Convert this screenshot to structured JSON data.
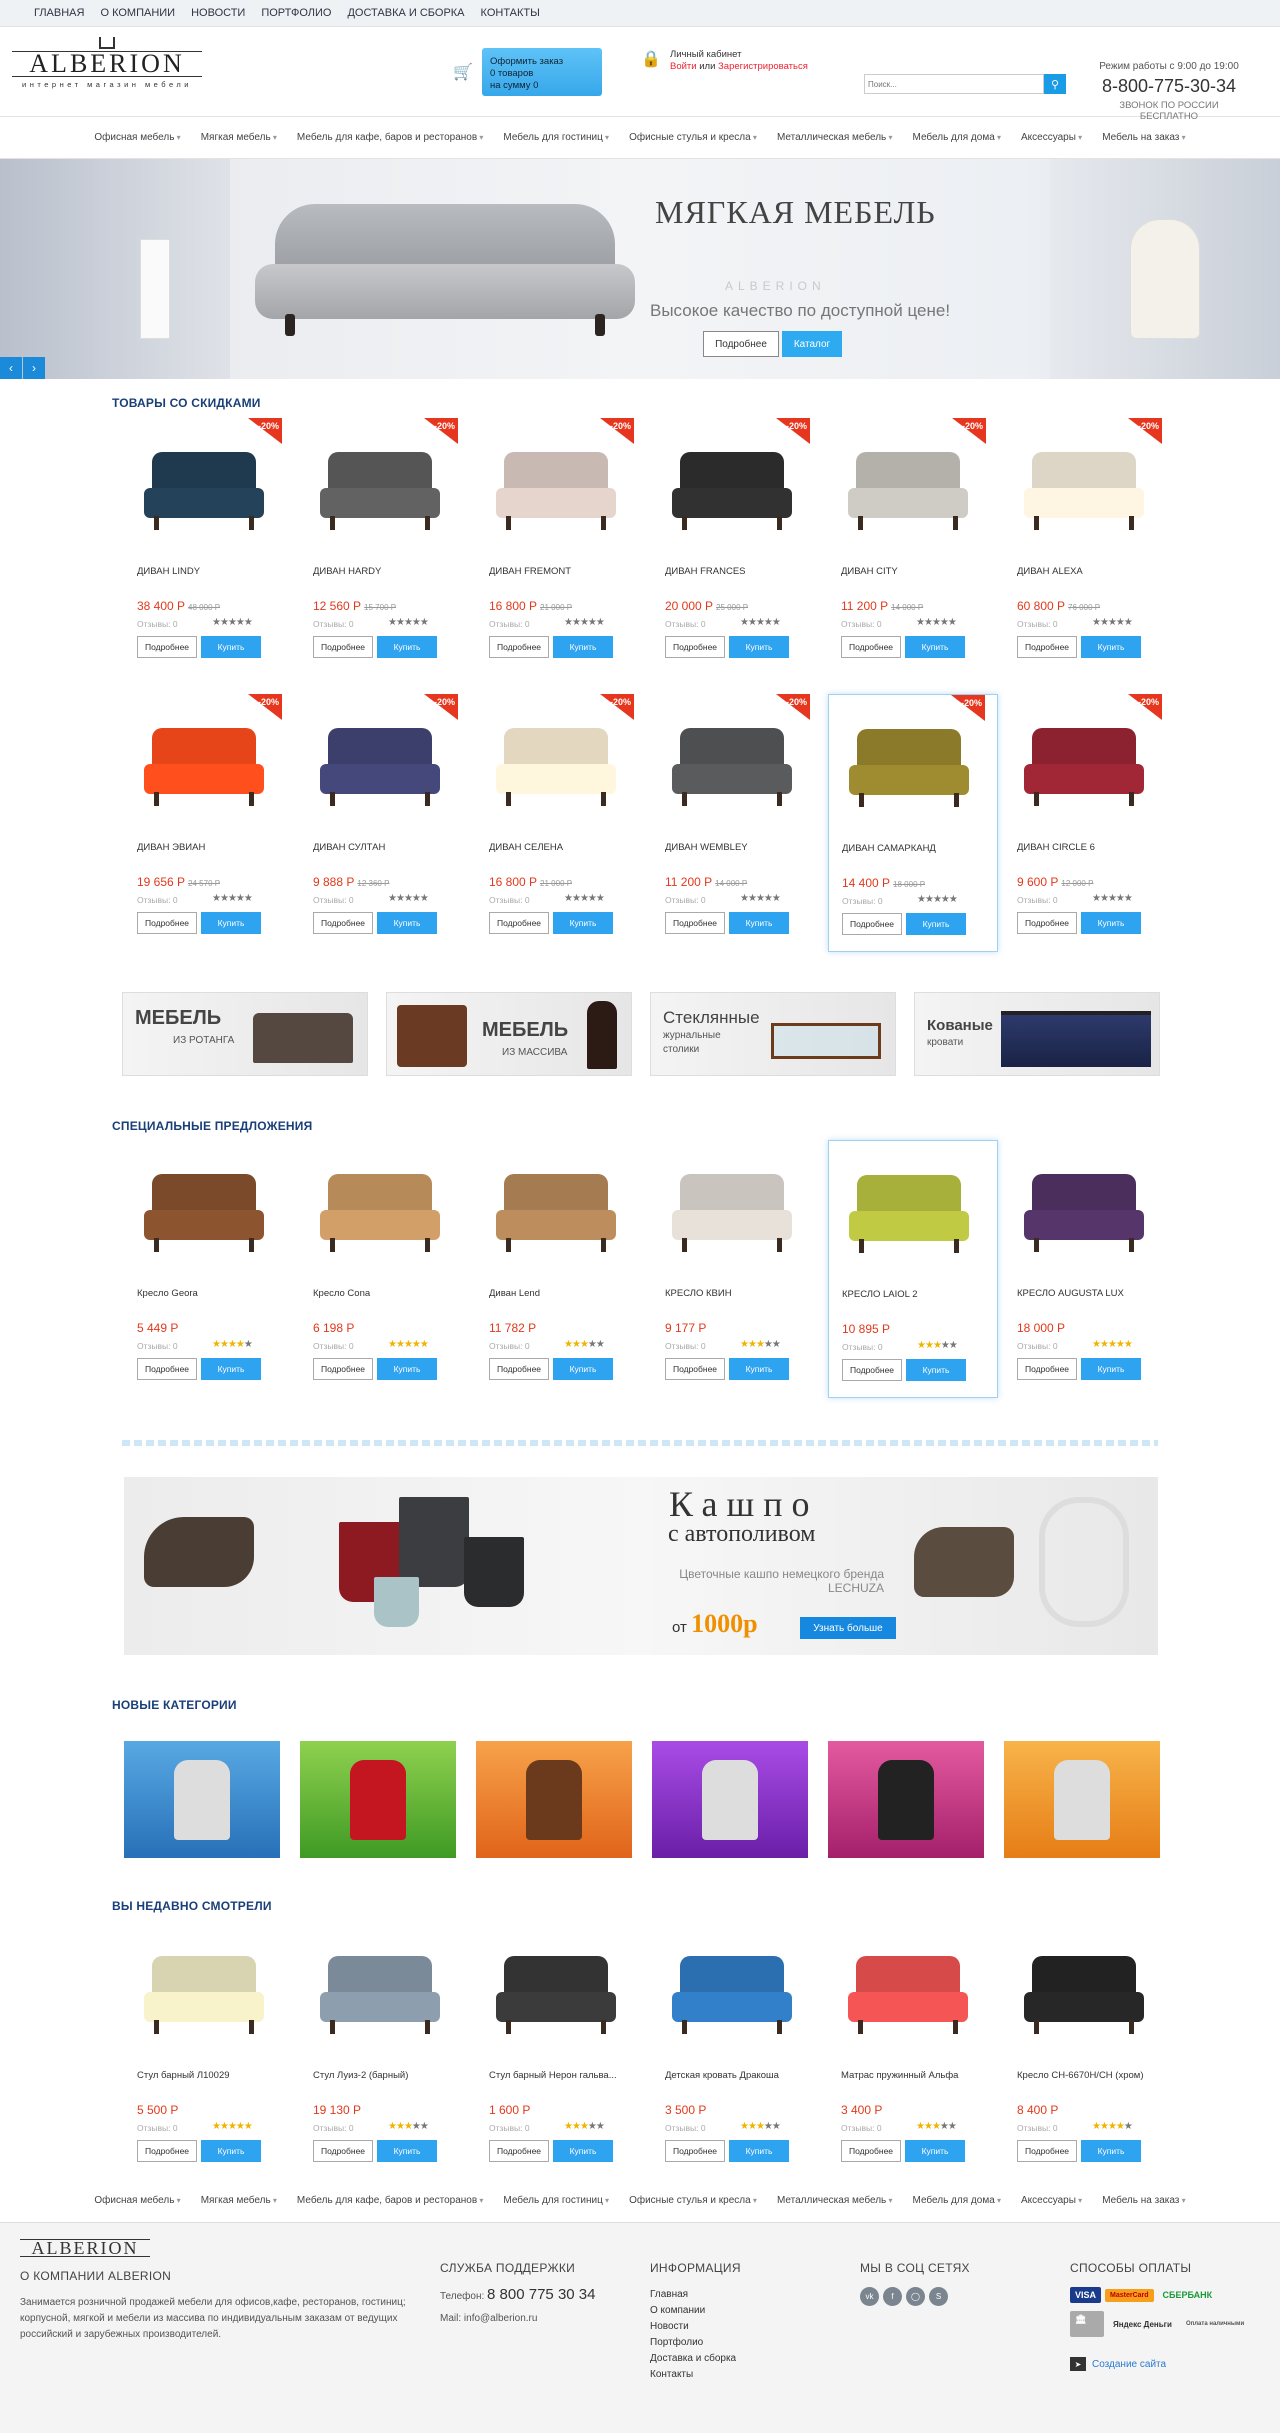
{
  "topnav": [
    "ГЛАВНАЯ",
    "О КОМПАНИИ",
    "НОВОСТИ",
    "ПОРТФОЛИО",
    "ДОСТАВКА И СБОРКА",
    "КОНТАКТЫ"
  ],
  "logo": {
    "word": "ALBERION",
    "sub": "интернет магазин мебели"
  },
  "cart": {
    "line1": "Оформить заказ",
    "line2": "0 товаров",
    "line3": "на сумму 0"
  },
  "cabinet": {
    "title": "Личный кабинет",
    "login": "Войти",
    "or": "или",
    "register": "Зарегистрироваться"
  },
  "search": {
    "placeholder": "Поиск..."
  },
  "contacts": {
    "hours": "Режим работы с 9:00 до 19:00",
    "phone": "8-800-775-30-34",
    "note": "ЗВОНОК ПО РОССИИ БЕСПЛАТНО"
  },
  "catnav": [
    "Офисная мебель",
    "Мягкая мебель",
    "Мебель для кафе, баров и ресторанов",
    "Мебель для гостиниц",
    "Офисные стулья и кресла",
    "Металлическая мебель",
    "Мебель для дома",
    "Аксессуары",
    "Мебель на заказ"
  ],
  "banner": {
    "title": "МЯГКАЯ МЕБЕЛЬ",
    "brand": "ALBERION",
    "subtitle": "Высокое качество по доступной цене!",
    "btn1": "Подробнее",
    "btn2": "Каталог"
  },
  "common": {
    "more": "Подробнее",
    "buy": "Купить",
    "reviews": "Отзывы: 0"
  },
  "sections": {
    "discounts": "ТОВАРЫ СО СКИДКАМИ",
    "special": "СПЕЦИАЛЬНЫЕ ПРЕДЛОЖЕНИЯ",
    "newcats": "НОВЫЕ КАТЕГОРИИ",
    "recent": "ВЫ НЕДАВНО СМОТРЕЛИ"
  },
  "discounts": [
    {
      "name": "ДИВАН LINDY",
      "price": "38 400 Р",
      "old": "48 000 Р",
      "badge": "-20%",
      "color": "#1f3a4f",
      "rating": 5
    },
    {
      "name": "ДИВАН HARDY",
      "price": "12 560 Р",
      "old": "15 700 Р",
      "badge": "-20%",
      "color": "#555",
      "rating": 5
    },
    {
      "name": "ДИВАН FREMONT",
      "price": "16 800 Р",
      "old": "21 000 Р",
      "badge": "-20%",
      "color": "#c8b9b2",
      "rating": 5
    },
    {
      "name": "ДИВАН FRANCES",
      "price": "20 000 Р",
      "old": "25 000 Р",
      "badge": "-20%",
      "color": "#2b2b2b",
      "rating": 5
    },
    {
      "name": "ДИВАН CITY",
      "price": "11 200 Р",
      "old": "14 000 Р",
      "badge": "-20%",
      "color": "#b4b1ab",
      "rating": 5
    },
    {
      "name": "ДИВАН ALEXA",
      "price": "60 800 Р",
      "old": "76 000 Р",
      "badge": "-20%",
      "color": "#ddd5c5",
      "rating": 5
    },
    {
      "name": "ДИВАН ЭВИАН",
      "price": "19 656 Р",
      "old": "24 570 Р",
      "badge": "-20%",
      "color": "#e64519",
      "rating": 5
    },
    {
      "name": "ДИВАН СУЛТАН",
      "price": "9 888 Р",
      "old": "12 360 Р",
      "badge": "-20%",
      "color": "#3c3f6b",
      "rating": 5
    },
    {
      "name": "ДИВАН СЕЛЕНА",
      "price": "16 800 Р",
      "old": "21 000 Р",
      "badge": "-20%",
      "color": "#e3d7c0",
      "rating": 5
    },
    {
      "name": "ДИВАН WEMBLEY",
      "price": "11 200 Р",
      "old": "14 000 Р",
      "badge": "-20%",
      "color": "#4d4f50",
      "rating": 5
    },
    {
      "name": "ДИВАН САМАРКАНД",
      "price": "14 400 Р",
      "old": "18 000 Р",
      "badge": "-20%",
      "color": "#8a7a2a",
      "rating": 5
    },
    {
      "name": "ДИВАН CIRCLE 6",
      "price": "9 600 Р",
      "old": "12 000 Р",
      "badge": "-20%",
      "color": "#8c2230",
      "rating": 5
    }
  ],
  "promos": [
    {
      "title": "МЕБЕЛЬ",
      "sub": "ИЗ РОТАНГА"
    },
    {
      "title": "МЕБЕЛЬ",
      "sub": "ИЗ МАССИВА"
    },
    {
      "title": "Стеклянные",
      "sub": "журнальные столики"
    },
    {
      "title": "Кованые",
      "sub": "кровати"
    }
  ],
  "special": [
    {
      "name": "Кресло Geora",
      "price": "5 449 Р",
      "color": "#7a4a2a",
      "rating": 4
    },
    {
      "name": "Кресло Cona",
      "price": "6 198 Р",
      "color": "#b78a5a",
      "rating": 5
    },
    {
      "name": "Диван Lend",
      "price": "11 782 Р",
      "color": "#a57b52",
      "rating": 3
    },
    {
      "name": "КРЕСЛО КВИН",
      "price": "9 177 Р",
      "color": "#c9c4bd",
      "rating": 3
    },
    {
      "name": "КРЕСЛО LAIOL 2",
      "price": "10 895 Р",
      "color": "#a7b03a",
      "rating": 3
    },
    {
      "name": "КРЕСЛО AUGUSTA LUX",
      "price": "18 000 Р",
      "color": "#4b2e5c",
      "rating": 5
    }
  ],
  "kashpo": {
    "title": "Кашпо",
    "subtitle": "с автополивом",
    "desc": "Цветочные кашпо немецкого бренда LECHUZA",
    "from": "от",
    "price": "1000р",
    "btn": "Узнать больше"
  },
  "tiles": [
    {
      "name": "tile-office-chairs",
      "bg": "linear-gradient(#58a9e3,#2770b8)",
      "color": "#ddd"
    },
    {
      "name": "tile-planters",
      "bg": "linear-gradient(#8fd14f,#3f9a24)",
      "color": "#c31621"
    },
    {
      "name": "tile-cafe-chairs",
      "bg": "linear-gradient(#f7a24a,#e0641a)",
      "color": "#6b3a1c"
    },
    {
      "name": "tile-bar-stools",
      "bg": "linear-gradient(#a94ce6,#6a1fa8)",
      "color": "#ddd"
    },
    {
      "name": "tile-table-bases",
      "bg": "linear-gradient(#e45aa0,#a4206a)",
      "color": "#222"
    },
    {
      "name": "tile-beds",
      "bg": "linear-gradient(#f7b44a,#e67d16)",
      "color": "#ddd"
    }
  ],
  "recent": [
    {
      "name": "Стул барный Л10029",
      "price": "5 500 Р",
      "color": "#d8d3b0",
      "rating": 5
    },
    {
      "name": "Стул Луиз-2 (барный)",
      "price": "19 130 Р",
      "color": "#7b8a98",
      "rating": 3
    },
    {
      "name": "Стул барный Нерон гальва...",
      "price": "1 600 Р",
      "color": "#333",
      "rating": 3
    },
    {
      "name": "Детская кровать Дракоша",
      "price": "3 500 Р",
      "color": "#2c6fb0",
      "rating": 3
    },
    {
      "name": "Матрас пружинный Альфа",
      "price": "3 400 Р",
      "color": "#d64a4a",
      "rating": 3
    },
    {
      "name": "Кресло CH-6670H/CH (хром)",
      "price": "8 400 Р",
      "color": "#222",
      "rating": 4
    }
  ],
  "footer": {
    "about_title": "О КОМПАНИИ ALBERION",
    "about_text": "Занимается розничной продажей мебели для офисов,кафе, ресторанов, гостиниц; корпусной, мягкой и мебели из массива по индивидуальным заказам от ведущих российский и зарубежных производителей.",
    "support_title": "СЛУЖБА ПОДДЕРЖКИ",
    "phone_label": "Телефон:",
    "phone": "8 800 775 30 34",
    "mail_label": "Mail:",
    "mail": "info@alberion.ru",
    "info_title": "ИНФОРМАЦИЯ",
    "info_links": [
      "Главная",
      "О компании",
      "Новости",
      "Портфолио",
      "Доставка и сборка",
      "Контакты"
    ],
    "social_title": "МЫ В СОЦ СЕТЯХ",
    "pay_title": "СПОСОБЫ ОПЛАТЫ",
    "pay": [
      "VISA",
      "MasterCard",
      "СБЕРБАНК",
      "Яндекс Деньги",
      "Оплата наличными"
    ],
    "site_credit": "Создание сайта"
  }
}
